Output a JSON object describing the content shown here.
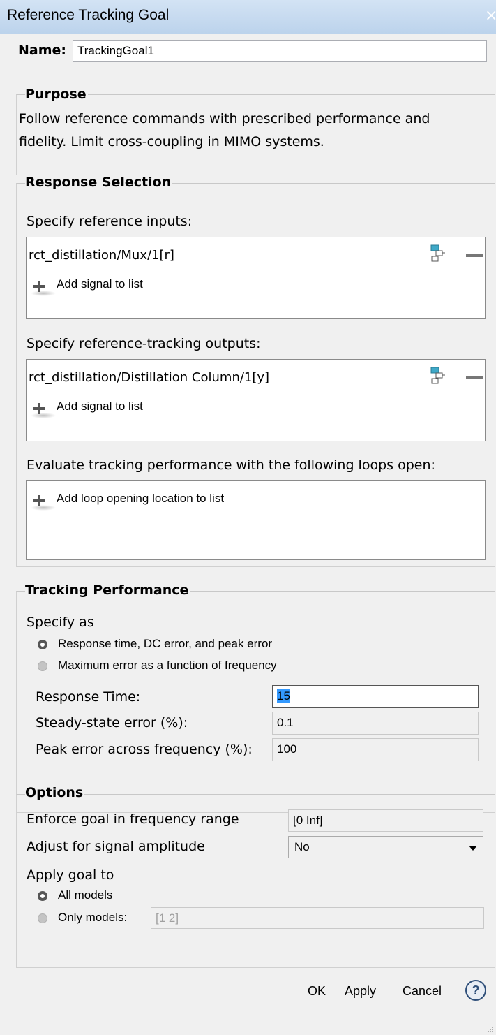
{
  "window": {
    "title": "Reference Tracking Goal",
    "close_glyph": "×"
  },
  "name": {
    "label": "Name:",
    "value": "TrackingGoal1"
  },
  "purpose": {
    "legend": "Purpose",
    "line1": "Follow reference commands with prescribed performance and",
    "line2": "fidelity. Limit cross-coupling in MIMO systems."
  },
  "response_selection": {
    "legend": "Response Selection",
    "inputs_label": "Specify reference inputs:",
    "inputs": [
      "rct_distillation/Mux/1[r]"
    ],
    "outputs_label": "Specify reference-tracking outputs:",
    "outputs": [
      "rct_distillation/Distillation Column/1[y]"
    ],
    "add_signal": "Add signal to list",
    "loops_label": "Evaluate tracking performance with the following loops open:",
    "add_loop": "Add loop opening location to list"
  },
  "tracking": {
    "legend": "Tracking Performance",
    "specify_as": "Specify as",
    "option1": "Response time, DC error, and peak error",
    "option2": "Maximum error as a function of frequency",
    "selected": "option1",
    "response_time_label": "Response Time:",
    "response_time": "15",
    "steady_state_label": "Steady-state error (%):",
    "steady_state": "0.1",
    "peak_error_label": "Peak error across frequency (%):",
    "peak_error": "100"
  },
  "options": {
    "legend": "Options",
    "freq_range_label": "Enforce goal in frequency range",
    "freq_range": "[0 Inf]",
    "amplitude_label": "Adjust for signal amplitude",
    "amplitude": "No",
    "apply_goal_label": "Apply goal to",
    "all_models": "All models",
    "only_models": "Only models:",
    "only_models_value": "[1 2]",
    "selected": "all_models"
  },
  "buttons": {
    "ok": "OK",
    "apply": "Apply",
    "cancel": "Cancel",
    "help": "?"
  },
  "icons": {
    "select_signal": "select-signal-icon",
    "remove": "minus-icon",
    "add": "plus-icon",
    "help": "help-icon"
  }
}
